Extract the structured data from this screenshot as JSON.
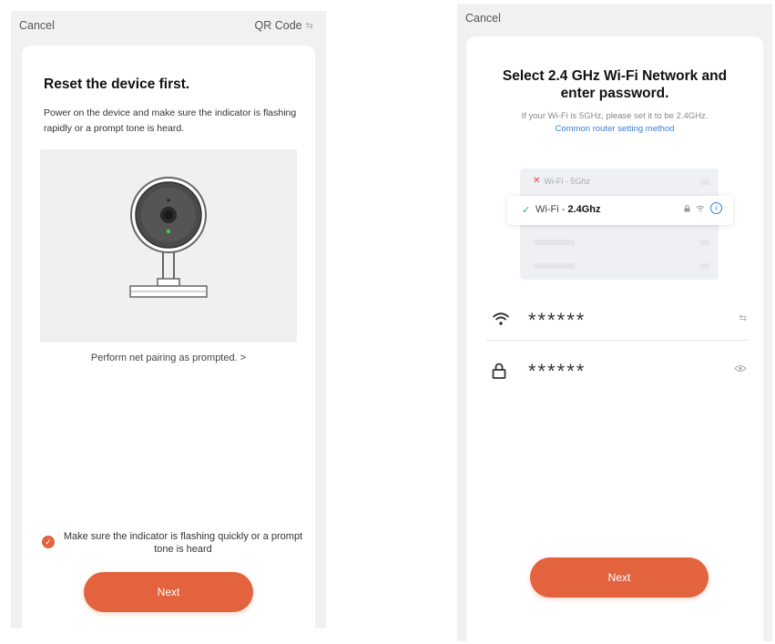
{
  "screen_left": {
    "topbar": {
      "cancel_label": "Cancel",
      "qr_label": "QR Code",
      "qr_icon": "⇆"
    },
    "title": "Reset the device first.",
    "description": "Power on the device and make sure the indicator is flashing rapidly or a prompt tone is heard.",
    "pair_link": "Perform net pairing as prompted. >",
    "confirm_text": "Make sure the indicator is flashing quickly or a prompt tone is heard",
    "next_label": "Next"
  },
  "screen_right": {
    "topbar": {
      "cancel_label": "Cancel"
    },
    "title_line1": "Select 2.4 GHz Wi-Fi Network and",
    "title_line2": "enter password.",
    "description": "If your Wi-Fi is 5GHz, please set it to be 2.4GHz.",
    "router_link": "Common router setting method",
    "illustration": {
      "network_5g": "Wi-Fi - 5Ghz",
      "network_24_prefix": "Wi-Fi -",
      "network_24_band": "2.4Ghz"
    },
    "wifi_field": {
      "value": "******",
      "switch_icon": "⇆"
    },
    "password_field": {
      "value": "******"
    },
    "next_label": "Next"
  },
  "colors": {
    "accent": "#e2633e",
    "link": "#3b7ed8",
    "check_green": "#3cae6b",
    "error_red": "#e04848",
    "background": "#f1f1f3"
  },
  "icons": [
    "qr-switch-icon",
    "camera-illustration",
    "checkmark-icon",
    "wifi-icon",
    "lock-icon",
    "eye-icon",
    "info-icon",
    "close-x-icon"
  ]
}
